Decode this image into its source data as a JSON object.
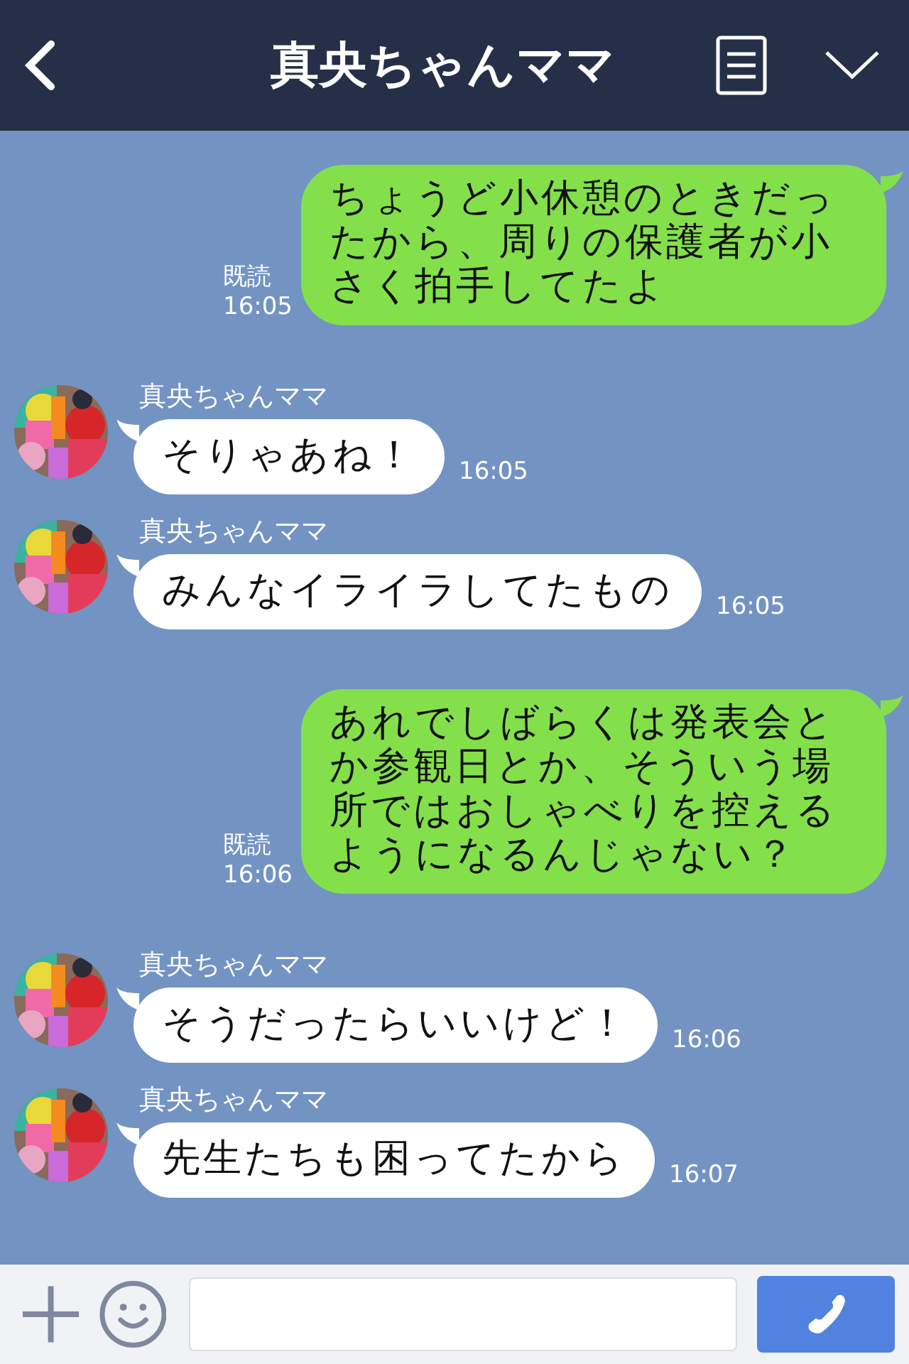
{
  "header": {
    "title": "真央ちゃんママ"
  },
  "messages": [
    {
      "kind": "sent",
      "text": "ちょうど小休憩のときだったから、周りの保護者が小さく拍手してたよ",
      "read": "既読",
      "time": "16:05"
    },
    {
      "kind": "received",
      "name": "真央ちゃんママ",
      "text": "そりゃあね！",
      "time": "16:05"
    },
    {
      "kind": "received",
      "name": "真央ちゃんママ",
      "text": "みんなイライラしてたもの",
      "time": "16:05"
    },
    {
      "kind": "sent",
      "text": "あれでしばらくは発表会とか参観日とか、そういう場所ではおしゃべりを控えるようになるんじゃない？",
      "read": "既読",
      "time": "16:06"
    },
    {
      "kind": "received",
      "name": "真央ちゃんママ",
      "text": "そうだったらいいけど！",
      "time": "16:06"
    },
    {
      "kind": "received",
      "name": "真央ちゃんママ",
      "text": "先生たちも困ってたから",
      "time": "16:07"
    }
  ]
}
